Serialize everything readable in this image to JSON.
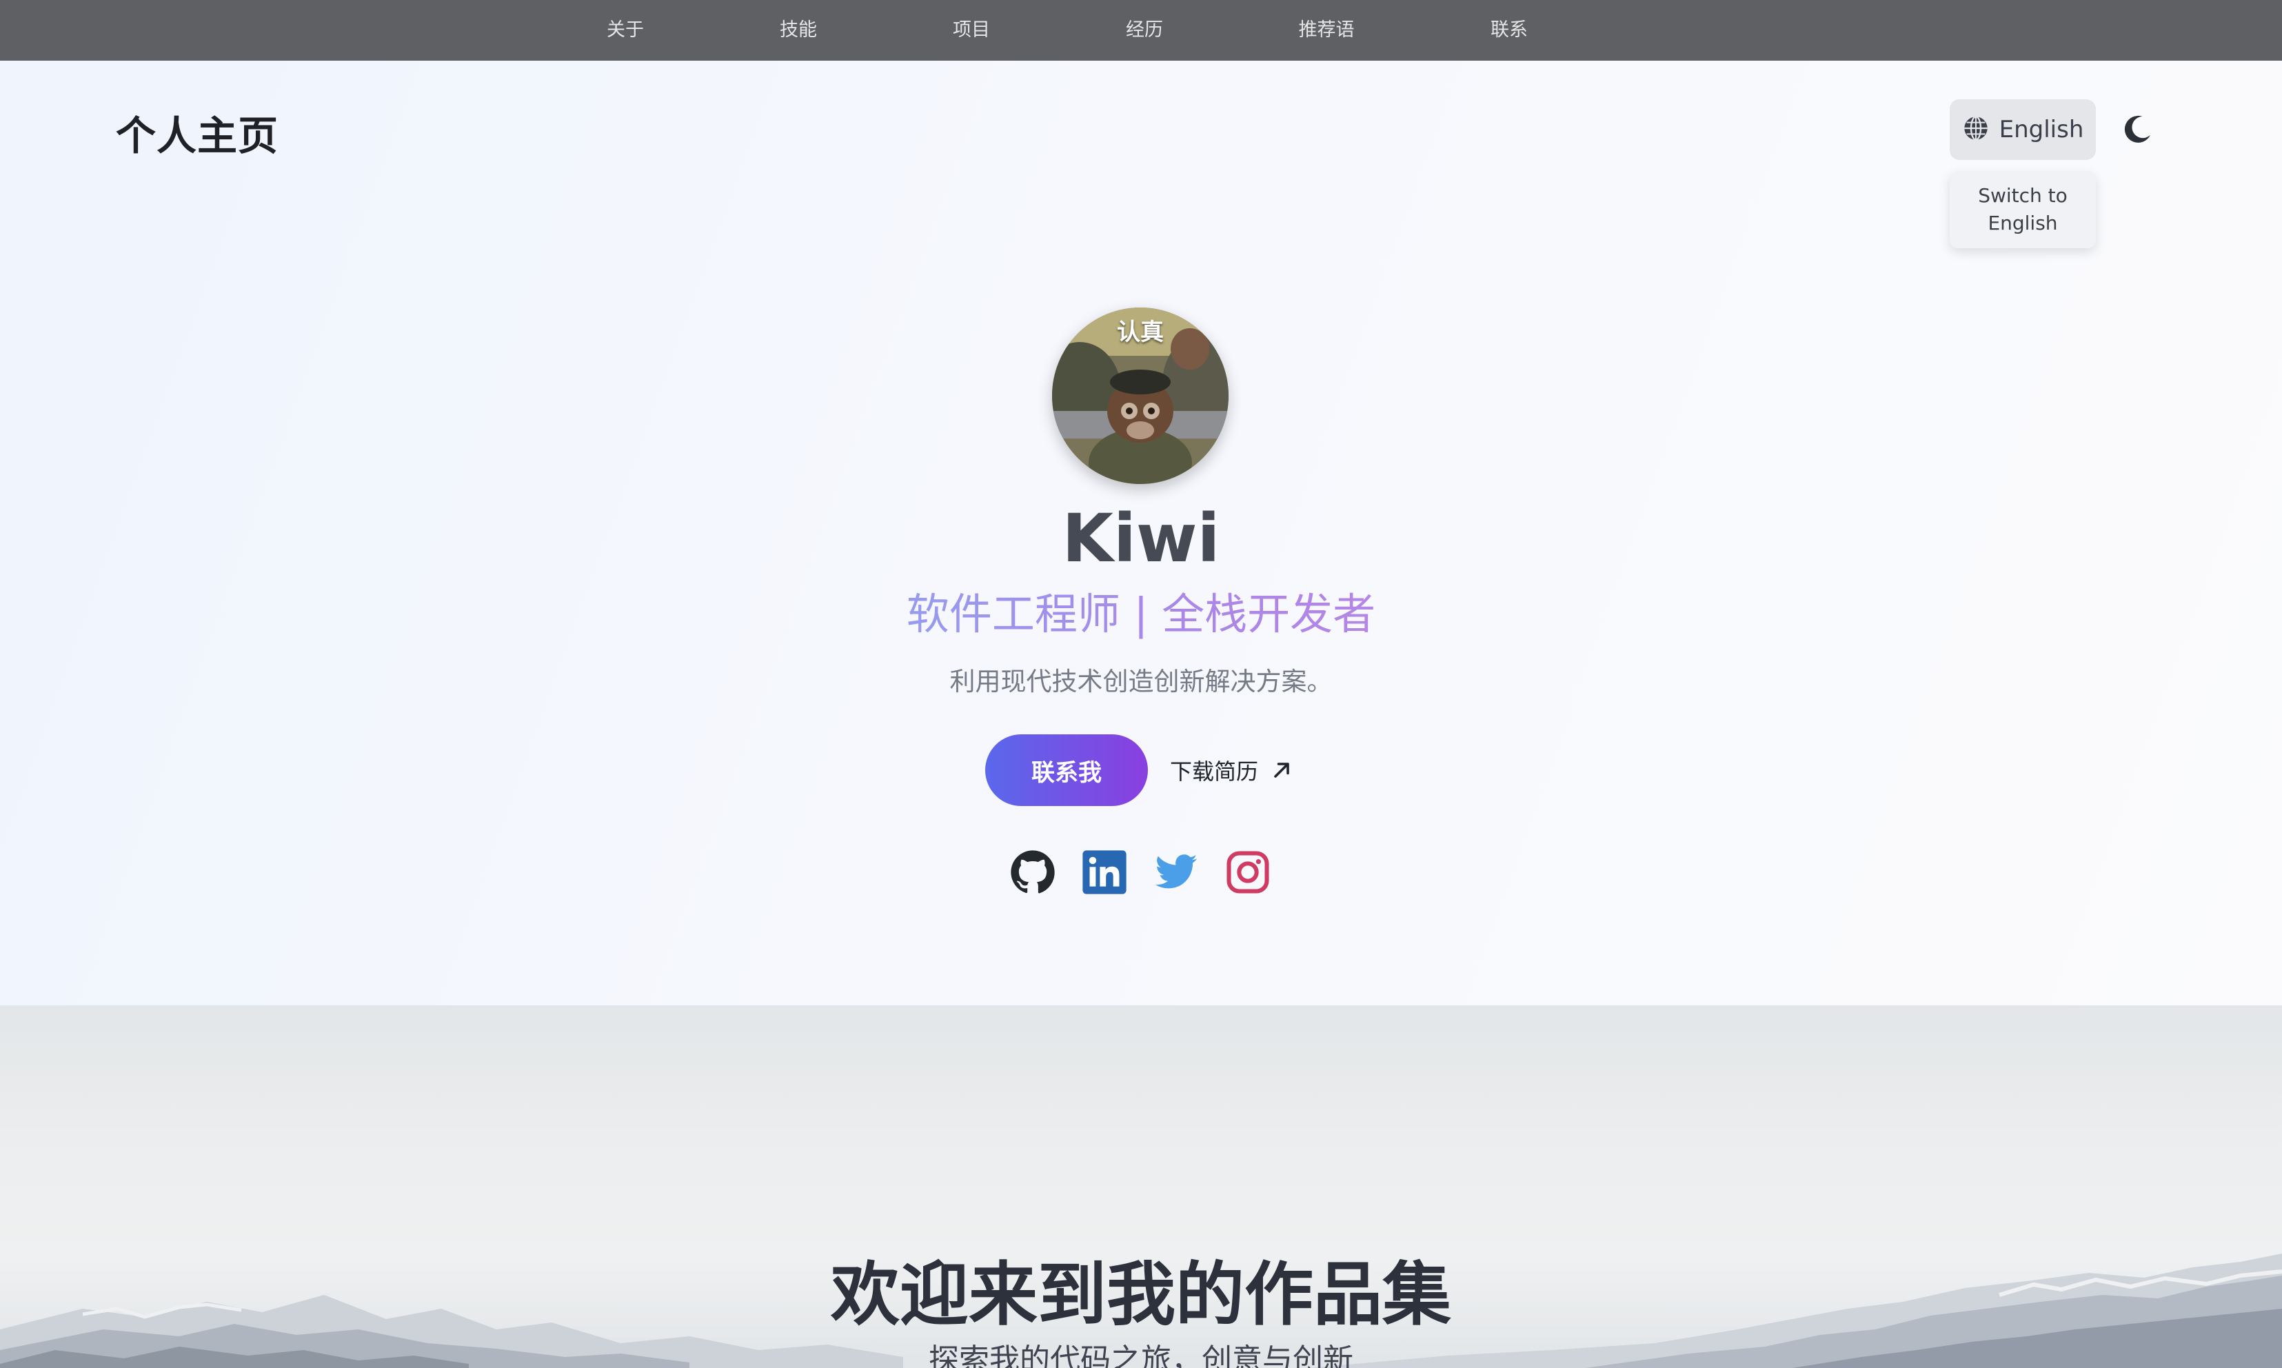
{
  "nav": {
    "items": [
      {
        "label": "关于"
      },
      {
        "label": "技能"
      },
      {
        "label": "项目"
      },
      {
        "label": "经历"
      },
      {
        "label": "推荐语"
      },
      {
        "label": "联系"
      }
    ]
  },
  "header": {
    "brand": "个人主页",
    "language_button": {
      "label": "English",
      "icon": "globe-icon"
    },
    "language_tooltip": "Switch to English",
    "theme_toggle": {
      "icon": "moon-icon"
    }
  },
  "hero": {
    "avatar_caption": "认真",
    "name": "Kiwi",
    "subtitle": "软件工程师 | 全栈开发者",
    "tagline": "利用现代技术创造创新解决方案。",
    "contact_button": "联系我",
    "resume_link": "下载简历",
    "social": [
      {
        "icon": "github-icon",
        "color": "#24292e"
      },
      {
        "icon": "linkedin-icon",
        "color": "#2867b2"
      },
      {
        "icon": "twitter-icon",
        "color": "#4a9fe8"
      },
      {
        "icon": "instagram-icon",
        "color": "#cf3b62"
      }
    ]
  },
  "banner": {
    "title": "欢迎来到我的作品集",
    "subtitle": "探索我的代码之旅，创意与创新"
  },
  "colors": {
    "nav_bg": "#5f6063",
    "accent_start": "#5a68ec",
    "accent_end": "#8a3fe0"
  }
}
